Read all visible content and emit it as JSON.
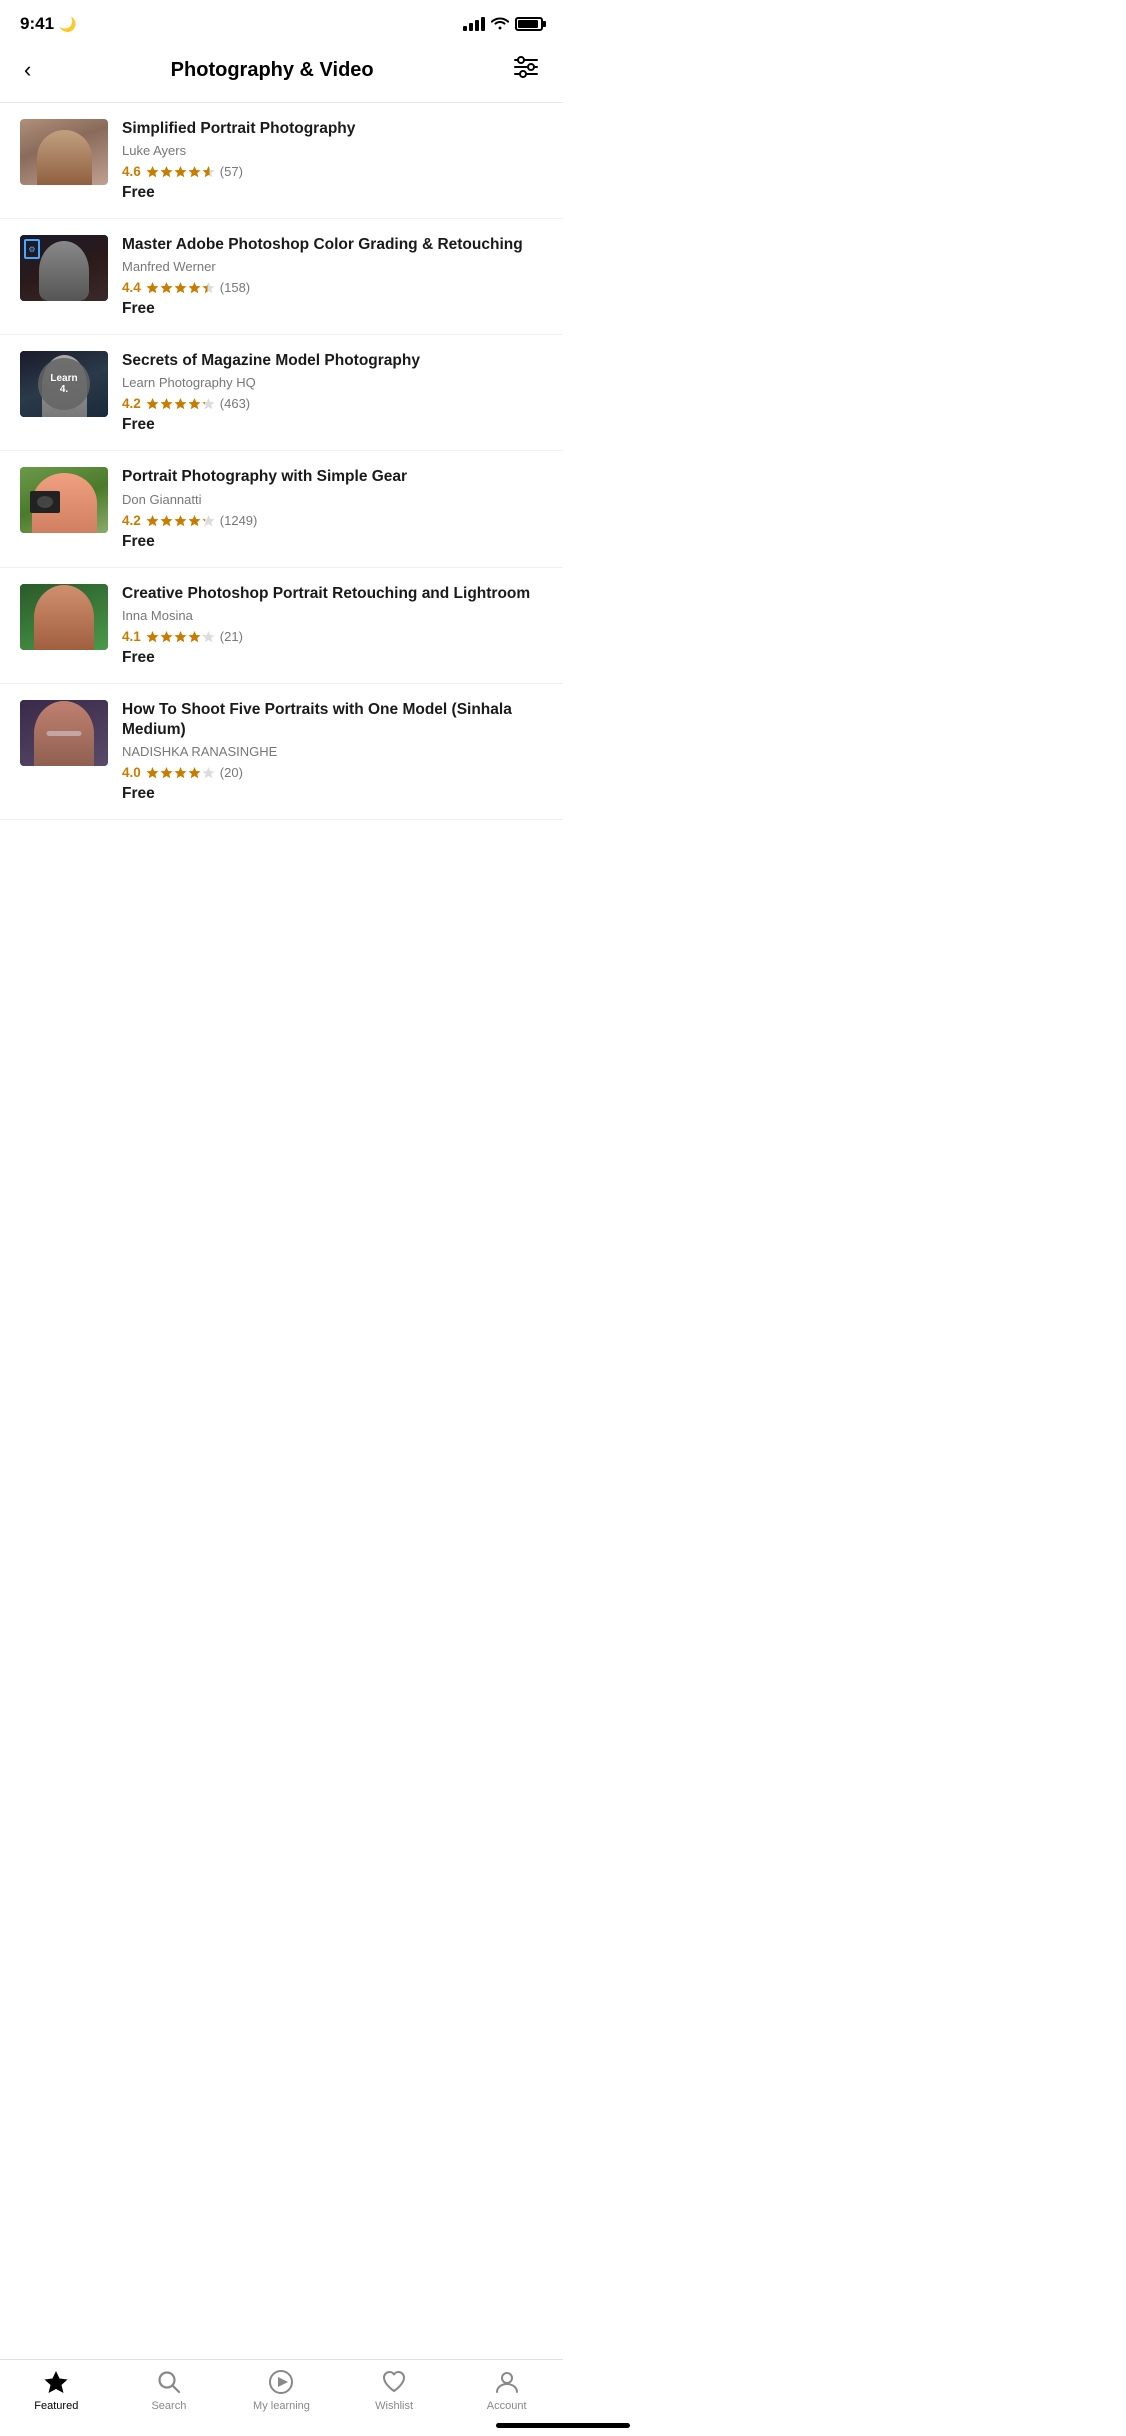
{
  "statusBar": {
    "time": "9:41",
    "moonIcon": "🌙"
  },
  "header": {
    "title": "Photography & Video",
    "backLabel": "‹",
    "filterLabel": "≡"
  },
  "courses": [
    {
      "id": 1,
      "title": "Simplified Portrait Photography",
      "author": "Luke Ayers",
      "rating": "4.6",
      "reviewCount": "(57)",
      "price": "Free",
      "thumbClass": "thumb-1"
    },
    {
      "id": 2,
      "title": "Master Adobe Photoshop Color Grading & Retouching",
      "author": "Manfred Werner",
      "rating": "4.4",
      "reviewCount": "(158)",
      "price": "Free",
      "thumbClass": "thumb-2",
      "hasLearnOverlay": false
    },
    {
      "id": 3,
      "title": "Secrets of Magazine Model Photography",
      "author": "Learn Photography HQ",
      "rating": "4.2",
      "reviewCount": "(463)",
      "price": "Free",
      "thumbClass": "thumb-3",
      "hasLearnOverlay": true
    },
    {
      "id": 4,
      "title": "Portrait Photography with Simple Gear",
      "author": "Don Giannatti",
      "rating": "4.2",
      "reviewCount": "(1249)",
      "price": "Free",
      "thumbClass": "thumb-4"
    },
    {
      "id": 5,
      "title": "Creative Photoshop Portrait Retouching and Lightroom",
      "author": "Inna Mosina",
      "rating": "4.1",
      "reviewCount": "(21)",
      "price": "Free",
      "thumbClass": "thumb-5"
    },
    {
      "id": 6,
      "title": "How To Shoot Five Portraits with One Model (Sinhala Medium)",
      "author": "NADISHKA RANASINGHE",
      "rating": "4.0",
      "reviewCount": "(20)",
      "price": "Free",
      "thumbClass": "thumb-6"
    }
  ],
  "bottomNav": {
    "items": [
      {
        "id": "featured",
        "label": "Featured",
        "icon": "star",
        "active": true
      },
      {
        "id": "search",
        "label": "Search",
        "icon": "search",
        "active": false
      },
      {
        "id": "my-learning",
        "label": "My learning",
        "icon": "play",
        "active": false
      },
      {
        "id": "wishlist",
        "label": "Wishlist",
        "icon": "heart",
        "active": false
      },
      {
        "id": "account",
        "label": "Account",
        "icon": "person",
        "active": false
      }
    ]
  },
  "learnOverlay": {
    "text": "Learn"
  }
}
